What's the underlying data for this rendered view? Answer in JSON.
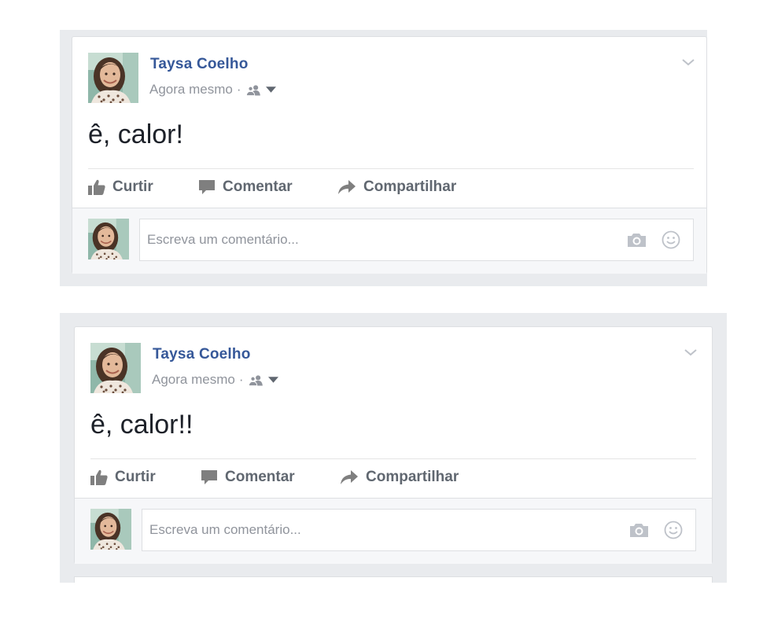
{
  "posts": [
    {
      "author": "Taysa Coelho",
      "time": "Agora mesmo",
      "separator": "·",
      "privacy_icon": "friends-icon",
      "message": "ê, calor!",
      "actions": {
        "like": "Curtir",
        "comment": "Comentar",
        "share": "Compartilhar"
      },
      "comment_placeholder": "Escreva um comentário..."
    },
    {
      "author": "Taysa Coelho",
      "time": "Agora mesmo",
      "separator": "·",
      "privacy_icon": "friends-icon",
      "message": "ê, calor!!",
      "actions": {
        "like": "Curtir",
        "comment": "Comentar",
        "share": "Compartilhar"
      },
      "comment_placeholder": "Escreva um comentário..."
    }
  ],
  "colors": {
    "author_link": "#365899",
    "meta_text": "#90949c",
    "action_text": "#606770",
    "icon_gray": "#90949c",
    "feed_background": "#e9ebee"
  }
}
